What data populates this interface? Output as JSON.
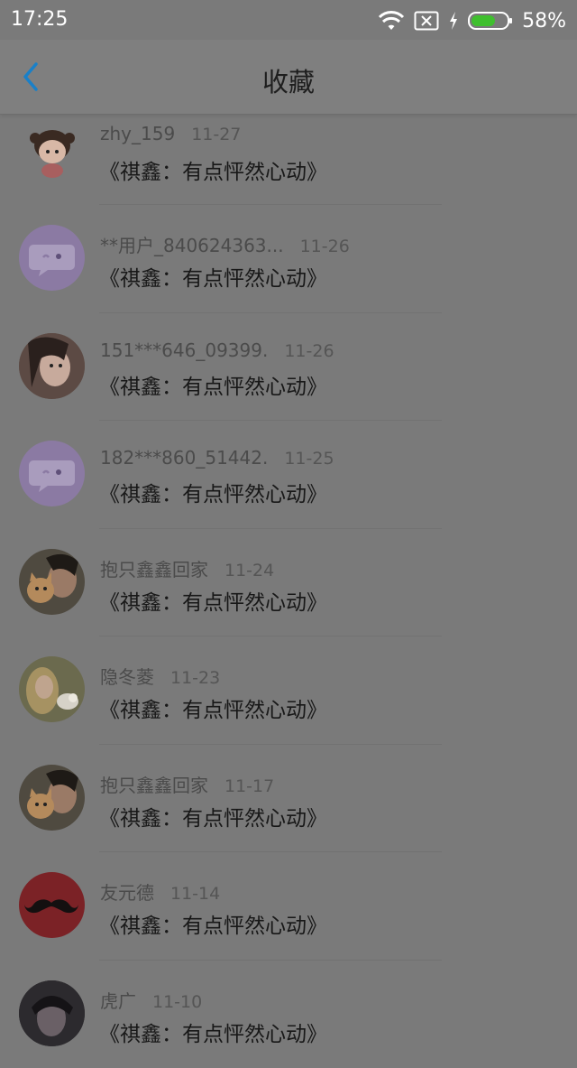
{
  "status": {
    "time": "17:25",
    "battery": "58%",
    "battery_level": 0.58,
    "icons": [
      "wifi-icon",
      "sim-missing-icon",
      "charging-icon",
      "battery-icon"
    ]
  },
  "header": {
    "title": "收藏",
    "back_icon": "chevron-left-icon",
    "accent_color": "#1a80c8"
  },
  "items": [
    {
      "name": "zhy_159",
      "date": "11-27",
      "title": "《祺鑫：有点怦然心动》",
      "avatar": "cartoon-girl"
    },
    {
      "name": "**用户_840624363...",
      "date": "11-26",
      "title": "《祺鑫：有点怦然心动》",
      "avatar": "default-chat"
    },
    {
      "name": "151***646_09399.",
      "date": "11-26",
      "title": "《祺鑫：有点怦然心动》",
      "avatar": "photo-woman"
    },
    {
      "name": "182***860_51442.",
      "date": "11-25",
      "title": "《祺鑫：有点怦然心动》",
      "avatar": "default-chat"
    },
    {
      "name": "抱只鑫鑫回家",
      "date": "11-24",
      "title": "《祺鑫：有点怦然心动》",
      "avatar": "photo-cat"
    },
    {
      "name": "隐冬菱",
      "date": "11-23",
      "title": "《祺鑫：有点怦然心动》",
      "avatar": "photo-blonde"
    },
    {
      "name": "抱只鑫鑫回家",
      "date": "11-17",
      "title": "《祺鑫：有点怦然心动》",
      "avatar": "photo-cat"
    },
    {
      "name": "友元德",
      "date": "11-14",
      "title": "《祺鑫：有点怦然心动》",
      "avatar": "mustache"
    },
    {
      "name": "虎广",
      "date": "11-10",
      "title": "《祺鑫：有点怦然心动》",
      "avatar": "photo-dark"
    }
  ]
}
